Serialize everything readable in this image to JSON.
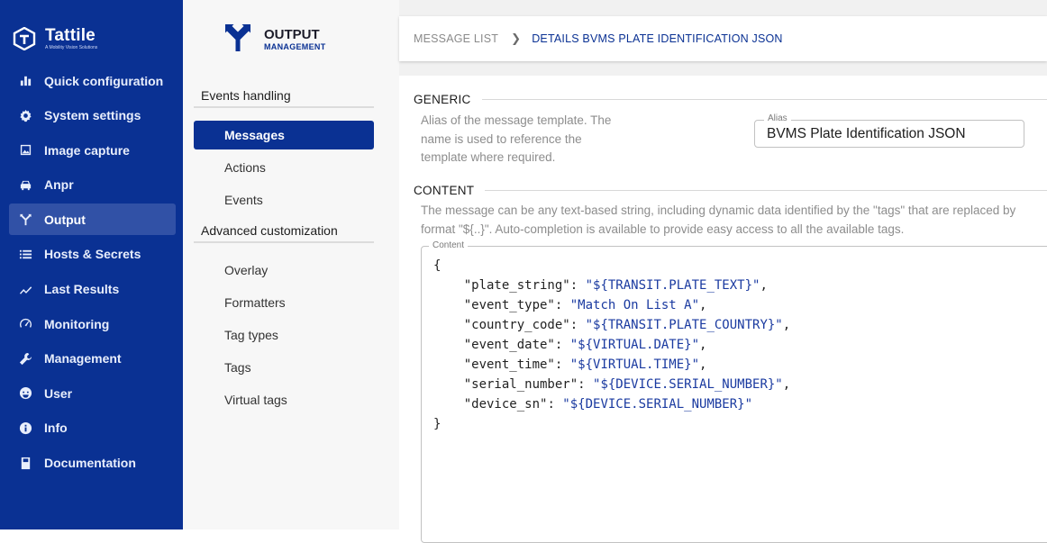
{
  "brand": {
    "name": "Tattile",
    "subtitle": "A Mobility Vision Solutions"
  },
  "sidebar": {
    "items": [
      {
        "label": "Quick configuration",
        "icon": "bar-chart-icon"
      },
      {
        "label": "System settings",
        "icon": "gear-icon"
      },
      {
        "label": "Image capture",
        "icon": "image-icon"
      },
      {
        "label": "Anpr",
        "icon": "car-icon"
      },
      {
        "label": "Output",
        "icon": "fork-arrow-icon",
        "active": true
      },
      {
        "label": "Hosts & Secrets",
        "icon": "list-icon"
      },
      {
        "label": "Last Results",
        "icon": "trend-icon"
      },
      {
        "label": "Monitoring",
        "icon": "gauge-icon"
      },
      {
        "label": "Management",
        "icon": "wrench-icon"
      },
      {
        "label": "User",
        "icon": "user-icon"
      },
      {
        "label": "Info",
        "icon": "info-icon"
      },
      {
        "label": "Documentation",
        "icon": "book-icon"
      }
    ]
  },
  "subnav": {
    "title": "OUTPUT",
    "subtitle": "MANAGEMENT",
    "section1": "Events handling",
    "section1_items": [
      "Messages",
      "Actions",
      "Events"
    ],
    "section2": "Advanced customization",
    "section2_items": [
      "Overlay",
      "Formatters",
      "Tag types",
      "Tags",
      "Virtual tags"
    ]
  },
  "breadcrumb": {
    "parent": "MESSAGE LIST",
    "current": "DETAILS BVMS PLATE IDENTIFICATION JSON"
  },
  "generic": {
    "title": "GENERIC",
    "desc_lines": [
      "Alias of the message template. The",
      "name is used to reference the",
      "template where required."
    ],
    "alias_label": "Alias",
    "alias_value": "BVMS Plate Identification JSON"
  },
  "content": {
    "title": "CONTENT",
    "desc_lines": [
      "The message can be any text-based string, including dynamic data identified by the \"tags\" that are replaced by",
      "format \"${..}\". Auto-completion is available to provide easy access to all the available tags."
    ],
    "field_label": "Content",
    "open_brace": "{",
    "close_brace": "}",
    "entries": [
      {
        "key": "\"plate_string\"",
        "value": "\"${TRANSIT.PLATE_TEXT}\"",
        "comma": ","
      },
      {
        "key": "\"event_type\"",
        "value": "\"Match On List A\"",
        "comma": ","
      },
      {
        "key": "\"country_code\"",
        "value": "\"${TRANSIT.PLATE_COUNTRY}\"",
        "comma": ","
      },
      {
        "key": "\"event_date\"",
        "value": "\"${VIRTUAL.DATE}\"",
        "comma": ","
      },
      {
        "key": "\"event_time\"",
        "value": "\"${VIRTUAL.TIME}\"",
        "comma": ","
      },
      {
        "key": "\"serial_number\"",
        "value": "\"${DEVICE.SERIAL_NUMBER}\"",
        "comma": ","
      },
      {
        "key": "\"device_sn\"",
        "value": "\"${DEVICE.SERIAL_NUMBER}\"",
        "comma": ""
      }
    ]
  },
  "colors": {
    "sidebar_bg": "#0a3193",
    "accent": "#0a3193",
    "active_nav": "#3151a6"
  }
}
